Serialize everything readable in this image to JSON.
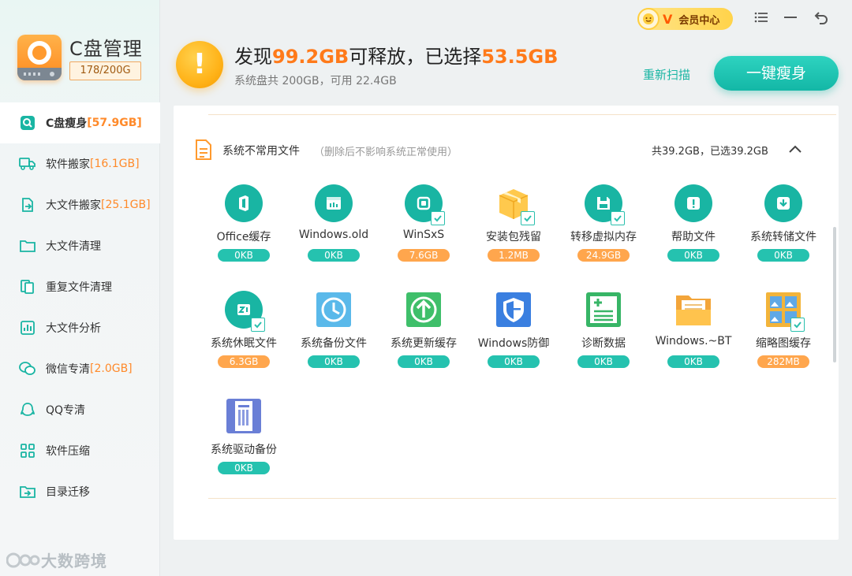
{
  "app": {
    "title": "C盘管理",
    "storage_badge": "178/200G",
    "watermark": "大数跨境"
  },
  "sidebar": {
    "items": [
      {
        "label": "C盘瘦身",
        "count": "[57.9GB]",
        "icon": "disk-search-icon",
        "active": true
      },
      {
        "label": "软件搬家",
        "count": "[16.1GB]",
        "icon": "truck-icon"
      },
      {
        "label": "大文件搬家",
        "count": "[25.1GB]",
        "icon": "file-move-icon"
      },
      {
        "label": "大文件清理",
        "count": "",
        "icon": "folder-icon"
      },
      {
        "label": "重复文件清理",
        "count": "",
        "icon": "duplicate-icon"
      },
      {
        "label": "大文件分析",
        "count": "",
        "icon": "chart-icon"
      },
      {
        "label": "微信专清",
        "count": "[2.0GB]",
        "icon": "wechat-icon"
      },
      {
        "label": "QQ专清",
        "count": "",
        "icon": "qq-icon"
      },
      {
        "label": "软件压缩",
        "count": "",
        "icon": "grid-icon"
      },
      {
        "label": "目录迁移",
        "count": "",
        "icon": "folder-arrow-icon"
      }
    ]
  },
  "header": {
    "headline_prefix": "发现",
    "found_size": "99.2GB",
    "headline_mid": "可释放，已选择",
    "selected_size": "53.5GB",
    "subline": "系统盘共 200GB，可用 22.4GB",
    "rescan_label": "重新扫描",
    "slim_button_label": "一键瘦身",
    "vip_label": "会员中心",
    "vip_badge": "V"
  },
  "section": {
    "title": "系统不常用文件",
    "description": "（删除后不影响系统正常使用）",
    "summary": "共39.2GB，已选39.2GB",
    "items": [
      {
        "name": "Office缓存",
        "size": "0KB",
        "icon": "office-icon",
        "checked": false,
        "highlight": false
      },
      {
        "name": "Windows.old",
        "size": "0KB",
        "icon": "window-icon",
        "checked": false,
        "highlight": false
      },
      {
        "name": "WinSxS",
        "size": "7.6GB",
        "icon": "winsxs-icon",
        "checked": true,
        "highlight": true
      },
      {
        "name": "安装包残留",
        "size": "1.2MB",
        "icon": "package-box-icon",
        "checked": true,
        "highlight": true
      },
      {
        "name": "转移虚拟内存",
        "size": "24.9GB",
        "icon": "floppy-icon",
        "checked": true,
        "highlight": true
      },
      {
        "name": "帮助文件",
        "size": "0KB",
        "icon": "help-icon",
        "checked": false,
        "highlight": false
      },
      {
        "name": "系统转储文件",
        "size": "0KB",
        "icon": "download-icon",
        "checked": false,
        "highlight": false
      },
      {
        "name": "系统休眠文件",
        "size": "6.3GB",
        "icon": "zzz-sleep-icon",
        "checked": true,
        "highlight": true
      },
      {
        "name": "系统备份文件",
        "size": "0KB",
        "icon": "clock-icon",
        "checked": false,
        "highlight": false
      },
      {
        "name": "系统更新缓存",
        "size": "0KB",
        "icon": "update-arrow-icon",
        "checked": false,
        "highlight": false
      },
      {
        "name": "Windows防御",
        "size": "0KB",
        "icon": "shield-icon",
        "checked": false,
        "highlight": false
      },
      {
        "name": "诊断数据",
        "size": "0KB",
        "icon": "diagnostic-icon",
        "checked": false,
        "highlight": false
      },
      {
        "name": "Windows.~BT",
        "size": "0KB",
        "icon": "folder-doc-icon",
        "checked": false,
        "highlight": false
      },
      {
        "name": "缩略图缓存",
        "size": "282MB",
        "icon": "thumbnail-icon",
        "checked": true,
        "highlight": true
      },
      {
        "name": "系统驱动备份",
        "size": "0KB",
        "icon": "driver-icon",
        "checked": false,
        "highlight": false
      }
    ]
  },
  "colors": {
    "accent": "#19b5a3",
    "highlight": "#ff7a1a",
    "size_pill_orange": "#ffa64d"
  }
}
